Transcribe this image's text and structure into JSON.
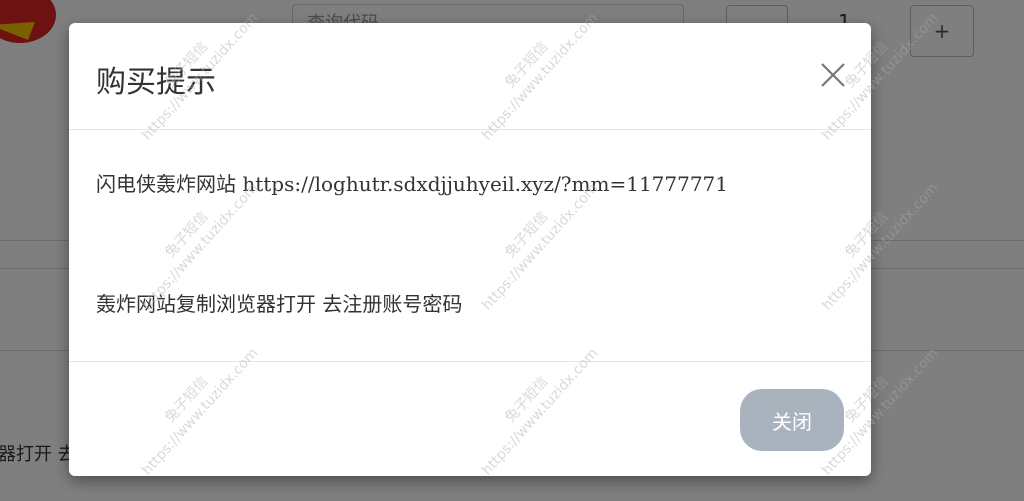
{
  "background": {
    "search_placeholder": "查询代码",
    "quantity": "1",
    "plus_label": "+",
    "partial_text": "器打开 去"
  },
  "modal": {
    "title": "购买提示",
    "body_line1": "闪电侠轰炸网站 https://loghutr.sdxdjjuhyeil.xyz/?mm=11777771",
    "body_line2": "轰炸网站复制浏览器打开 去注册账号密码",
    "close_button": "关闭",
    "close_icon": "close-icon"
  },
  "watermark": {
    "line1": "兔子短信",
    "line2": "https://www.tuzidx.com"
  },
  "colors": {
    "overlay": "rgba(0,0,0,0.5)",
    "button": "#a9b3be",
    "text": "#333333"
  }
}
